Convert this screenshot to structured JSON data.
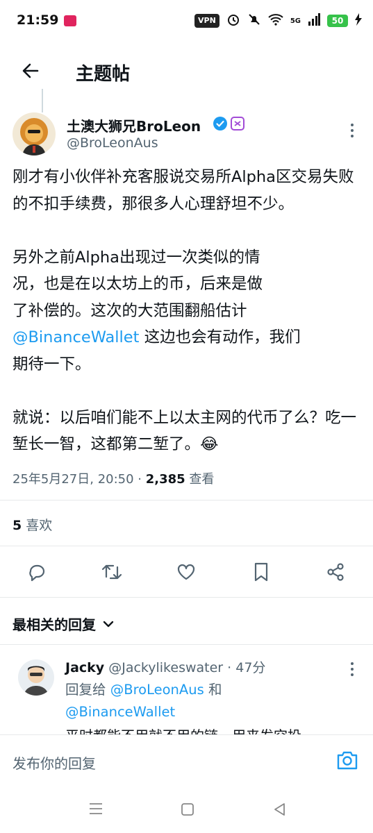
{
  "status": {
    "time": "21:59",
    "vpn": "VPN",
    "network": "5G",
    "battery": "50"
  },
  "header": {
    "title": "主题帖"
  },
  "tweet": {
    "author_name": "土澳大狮兄BroLeon",
    "handle": "@BroLeonAus",
    "para1": "刚才有小伙伴补充客服说交易所Alpha区交易失败的不扣手续费，那很多人心理舒坦不少。",
    "para2_line1": "另外之前Alpha出现过一次类似的情",
    "para2_line2": "况，也是在以太坊上的币，后来是做",
    "para2_line3": "了补偿的。这次的大范围翻船估计",
    "para2_mention": "@BinanceWallet",
    "para2_after_mention": " 这边也会有动作，我们",
    "para2_line5": "期待一下。",
    "para3": "就说：以后咱们能不上以太主网的代币了么？吃一堑长一智，这都第二堑了。😂",
    "timestamp": "25年5月27日, 20:50",
    "separator": " · ",
    "views_count": "2,385",
    "views_label": " 查看",
    "likes_count": "5",
    "likes_label": " 喜欢"
  },
  "replies_section": {
    "sort_label": "最相关的回复",
    "reply": {
      "name": "Jacky",
      "handle": "@Jackylikeswater",
      "time": " · 47分",
      "reply_to_prefix": "回复给 ",
      "reply_to_user1": "@BroLeonAus",
      "reply_to_and": " 和",
      "reply_to_user2": "@BinanceWallet",
      "text": "平时都能不用就不用的链，用来发空投"
    }
  },
  "compose": {
    "placeholder": "发布你的回复"
  },
  "colors": {
    "accent": "#1d9bf0",
    "text": "#0f1419",
    "muted": "#536471",
    "verified": "#1d9bf0"
  }
}
